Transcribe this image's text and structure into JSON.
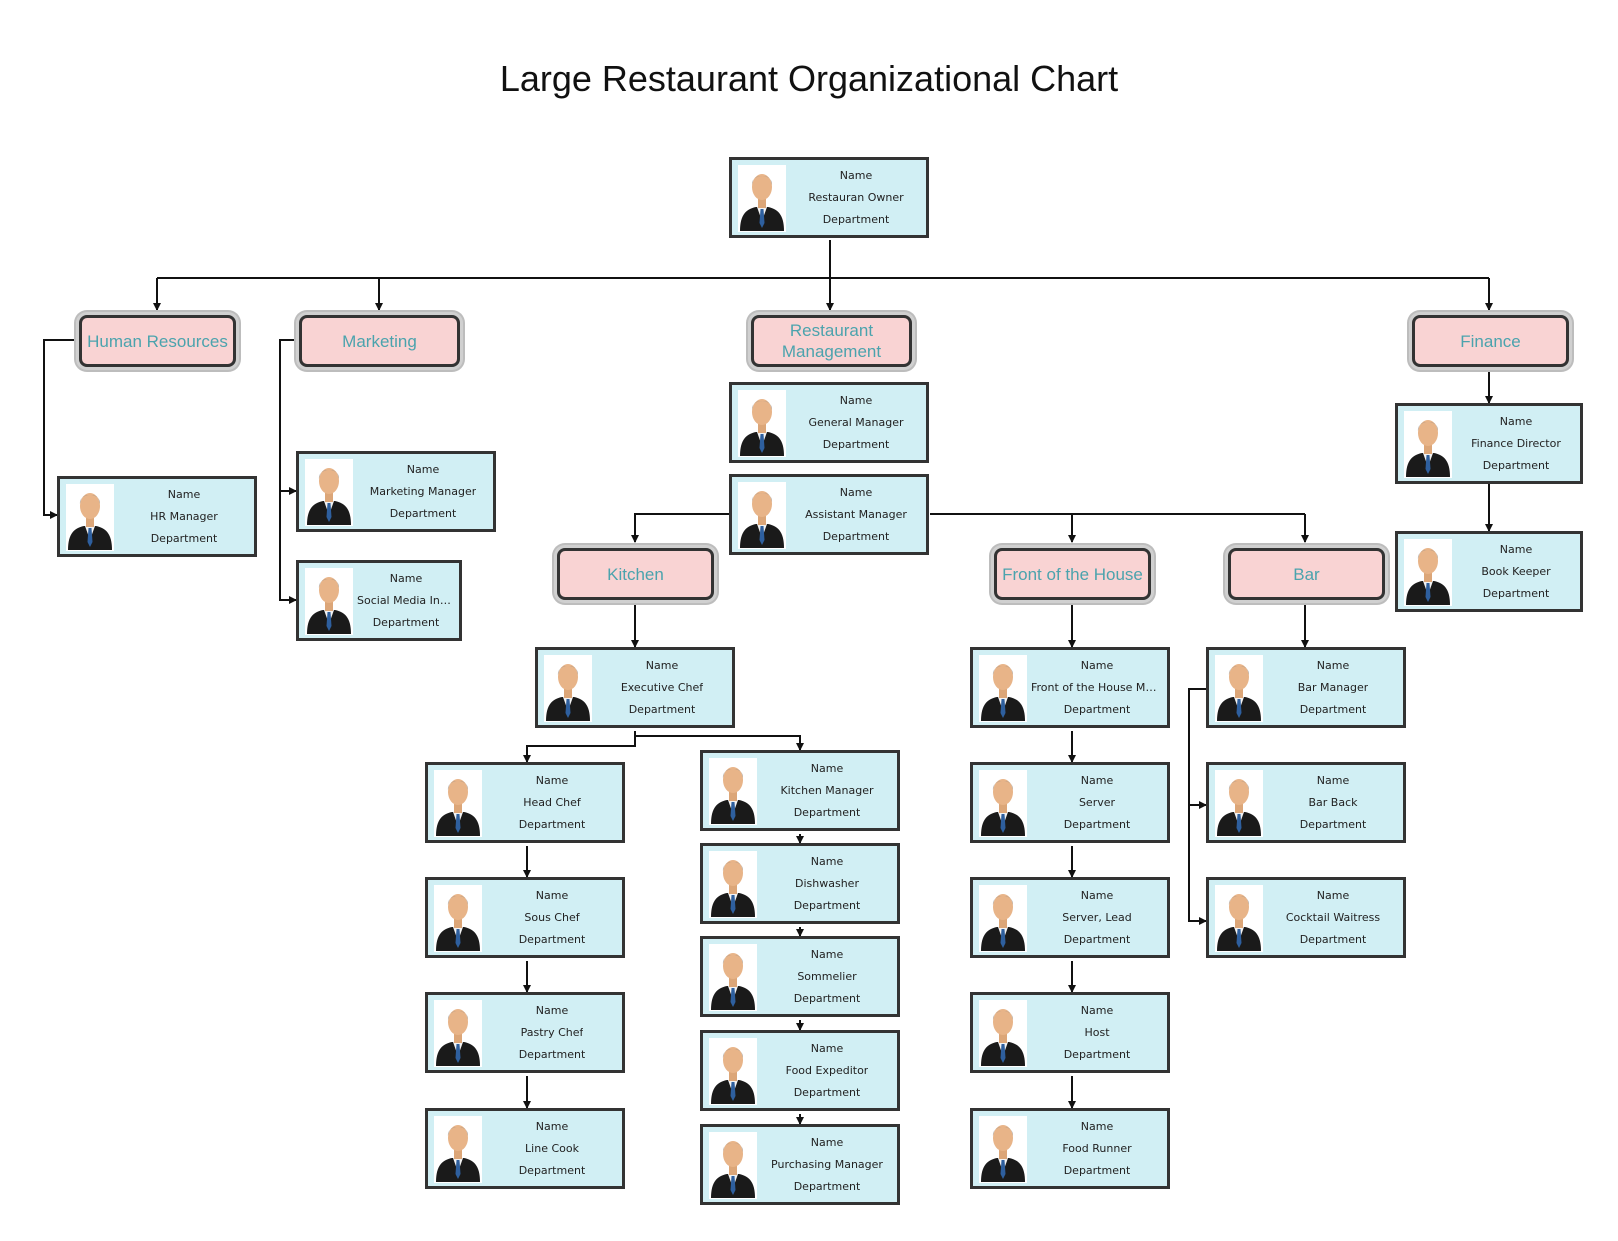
{
  "title": "Large Restaurant Organizational Chart",
  "departments": {
    "hr": "Human Resources",
    "marketing": "Marketing",
    "restaurant_management": "Restaurant Management",
    "finance": "Finance",
    "kitchen": "Kitchen",
    "front_of_house": "Front of the House",
    "bar": "Bar"
  },
  "cards": {
    "owner": {
      "name": "Name",
      "role": "Restauran Owner",
      "dept": "Department"
    },
    "hr_manager": {
      "name": "Name",
      "role": "HR Manager",
      "dept": "Department"
    },
    "marketing_manager": {
      "name": "Name",
      "role": "Marketing Manager",
      "dept": "Department"
    },
    "social_media_intern": {
      "name": "Name",
      "role": "Social Media Intern",
      "dept": "Department"
    },
    "general_manager": {
      "name": "Name",
      "role": "General Manager",
      "dept": "Department"
    },
    "assistant_manager": {
      "name": "Name",
      "role": "Assistant Manager",
      "dept": "Department"
    },
    "finance_director": {
      "name": "Name",
      "role": "Finance Director",
      "dept": "Department"
    },
    "book_keeper": {
      "name": "Name",
      "role": "Book Keeper",
      "dept": "Department"
    },
    "executive_chef": {
      "name": "Name",
      "role": "Executive Chef",
      "dept": "Department"
    },
    "head_chef": {
      "name": "Name",
      "role": "Head Chef",
      "dept": "Department"
    },
    "sous_chef": {
      "name": "Name",
      "role": "Sous Chef",
      "dept": "Department"
    },
    "pastry_chef": {
      "name": "Name",
      "role": "Pastry Chef",
      "dept": "Department"
    },
    "line_cook": {
      "name": "Name",
      "role": "Line Cook",
      "dept": "Department"
    },
    "kitchen_manager": {
      "name": "Name",
      "role": "Kitchen Manager",
      "dept": "Department"
    },
    "dishwasher": {
      "name": "Name",
      "role": "Dishwasher",
      "dept": "Department"
    },
    "sommelier": {
      "name": "Name",
      "role": "Sommelier",
      "dept": "Department"
    },
    "food_expeditor": {
      "name": "Name",
      "role": "Food Expeditor",
      "dept": "Department"
    },
    "purchasing_manager": {
      "name": "Name",
      "role": "Purchasing Manager",
      "dept": "Department"
    },
    "foh_manager": {
      "name": "Name",
      "role": "Front of the House Mana...",
      "dept": "Department"
    },
    "server": {
      "name": "Name",
      "role": "Server",
      "dept": "Department"
    },
    "server_lead": {
      "name": "Name",
      "role": "Server, Lead",
      "dept": "Department"
    },
    "host": {
      "name": "Name",
      "role": "Host",
      "dept": "Department"
    },
    "food_runner": {
      "name": "Name",
      "role": "Food Runner",
      "dept": "Department"
    },
    "bar_manager": {
      "name": "Name",
      "role": "Bar Manager",
      "dept": "Department"
    },
    "bar_back": {
      "name": "Name",
      "role": "Bar Back",
      "dept": "Department"
    },
    "cocktail_waitress": {
      "name": "Name",
      "role": "Cocktail Waitress",
      "dept": "Department"
    }
  },
  "colors": {
    "card_fill": "#d1eff4",
    "dept_fill": "#f9d3d3",
    "dept_text": "#4ba3ad",
    "border": "#333333"
  }
}
